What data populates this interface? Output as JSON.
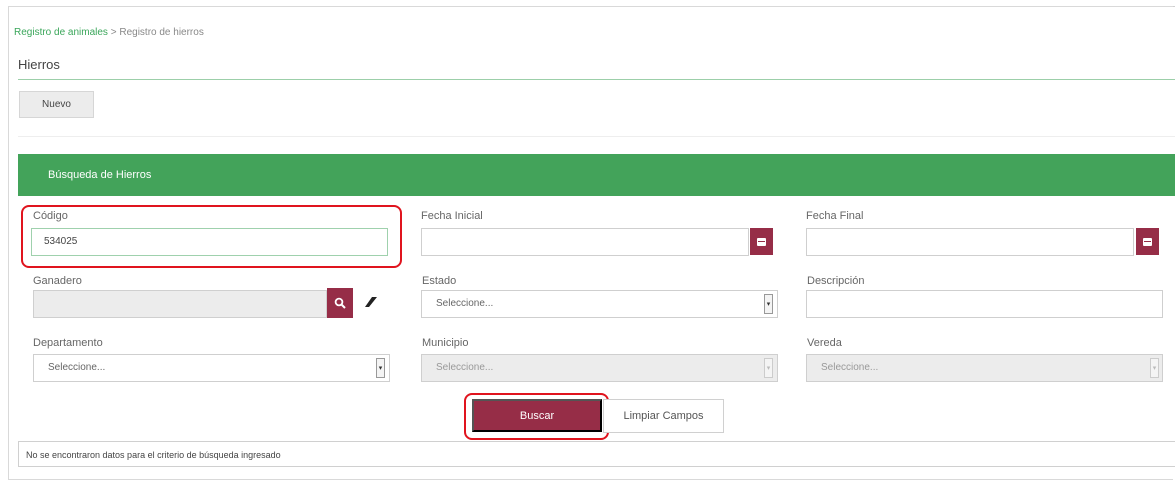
{
  "breadcrumb": {
    "parent": "Registro de animales",
    "separator": ">",
    "current": "Registro de hierros"
  },
  "page": {
    "title": "Hierros",
    "new_button": "Nuevo"
  },
  "panel": {
    "title": "Búsqueda de Hierros"
  },
  "form": {
    "codigo": {
      "label": "Código",
      "value": "534025"
    },
    "fecha_inicial": {
      "label": "Fecha Inicial",
      "value": ""
    },
    "fecha_final": {
      "label": "Fecha Final",
      "value": ""
    },
    "ganadero": {
      "label": "Ganadero",
      "value": ""
    },
    "estado": {
      "label": "Estado",
      "selected": "Seleccione..."
    },
    "descripcion": {
      "label": "Descripción",
      "value": ""
    },
    "departamento": {
      "label": "Departamento",
      "selected": "Seleccione..."
    },
    "municipio": {
      "label": "Municipio",
      "selected": "Seleccione..."
    },
    "vereda": {
      "label": "Vereda",
      "selected": "Seleccione..."
    }
  },
  "actions": {
    "search_label": "Buscar",
    "clear_label": "Limpiar Campos"
  },
  "result_message": "No se encontraron datos para el criterio de búsqueda ingresado",
  "icons": {
    "calendar": "calendar-icon",
    "search": "search-icon",
    "eraser": "eraser-icon",
    "dropdown": "chevron-down-icon"
  },
  "colors": {
    "header_green": "#43a35a",
    "accent_maroon": "#962d47",
    "highlight_red": "#e0141e",
    "link_green": "#3aa65a"
  }
}
